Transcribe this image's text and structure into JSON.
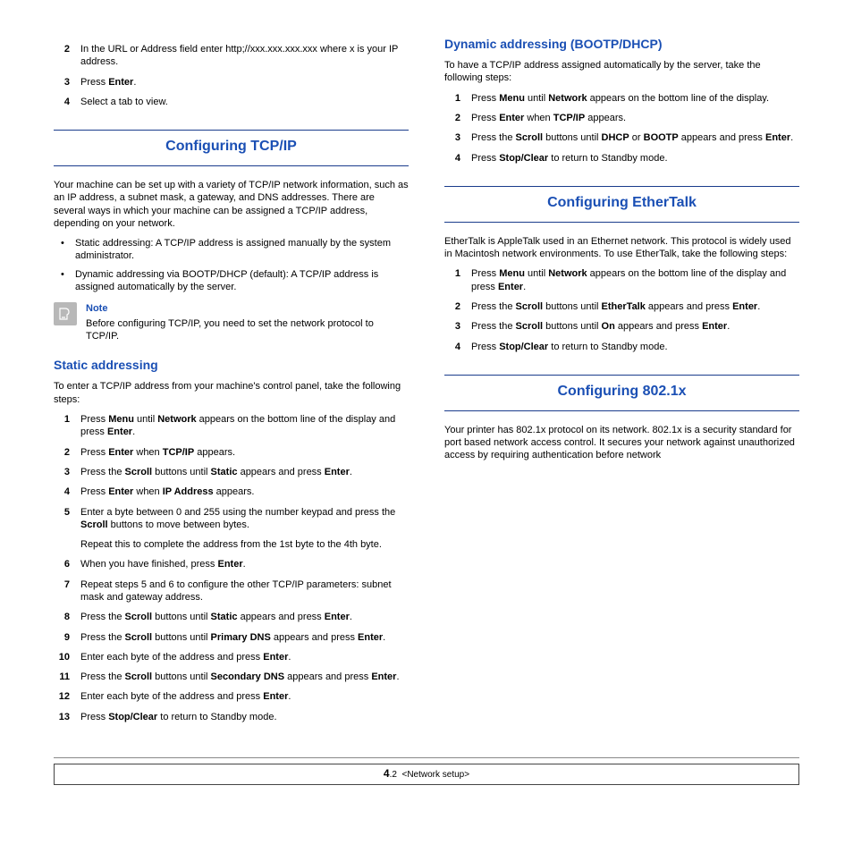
{
  "left": {
    "presteps": [
      {
        "n": "2",
        "t": "In the URL or Address field enter http;//xxx.xxx.xxx.xxx where x is your IP address."
      },
      {
        "n": "3",
        "t": "Press <b>Enter</b>."
      },
      {
        "n": "4",
        "t": "Select a tab to view."
      }
    ],
    "s1": {
      "title": "Configuring TCP/IP",
      "intro": "Your machine can be set up with a variety of TCP/IP network information, such as an IP address, a subnet mask, a gateway, and DNS addresses. There are several ways in which your machine can be assigned a TCP/IP address, depending on your network.",
      "bullets": [
        "Static addressing: A TCP/IP address is assigned manually by the system administrator.",
        "Dynamic addressing via BOOTP/DHCP (default): A TCP/IP address is assigned automatically by the server."
      ],
      "noteTitle": "Note",
      "noteText": "Before configuring TCP/IP, you need to set the network protocol to TCP/IP."
    },
    "static": {
      "title": "Static addressing",
      "intro": "To enter a TCP/IP address from your machine's control panel, take the following steps:",
      "steps": [
        {
          "n": "1",
          "t": "Press <b>Menu</b> until <b>Network</b> appears on the bottom line of the display and press <b>Enter</b>."
        },
        {
          "n": "2",
          "t": "Press <b>Enter</b> when <b>TCP/IP</b> appears."
        },
        {
          "n": "3",
          "t": "Press the <b>Scroll</b> buttons until <b>Static</b> appears and press <b>Enter</b>."
        },
        {
          "n": "4",
          "t": "Press <b>Enter</b> when <b>IP Address</b> appears."
        },
        {
          "n": "5",
          "t": "Enter a byte between 0 and 255 using the number keypad and press the <b>Scroll</b> buttons to move between bytes."
        },
        {
          "n": "",
          "t": "Repeat this to complete the address from the 1st byte to the 4th byte.",
          "indent": true
        },
        {
          "n": "6",
          "t": "When you have finished, press <b>Enter</b>."
        },
        {
          "n": "7",
          "t": "Repeat steps 5 and 6 to configure the other TCP/IP parameters: subnet mask and gateway address."
        },
        {
          "n": "8",
          "t": "Press the <b>Scroll</b> buttons until <b>Static</b> appears and press <b>Enter</b>."
        },
        {
          "n": "9",
          "t": "Press the <b>Scroll</b> buttons until <b>Primary DNS</b> appears and press <b>Enter</b>."
        },
        {
          "n": "10",
          "t": "Enter each byte of the address and press <b>Enter</b>."
        },
        {
          "n": "11",
          "t": "Press the <b>Scroll</b> buttons until <b>Secondary DNS</b> appears and press <b>Enter</b>."
        },
        {
          "n": "12",
          "t": "Enter each byte of the address and press <b>Enter</b>."
        },
        {
          "n": "13",
          "t": "Press <b>Stop/Clear</b> to return to Standby mode."
        }
      ]
    }
  },
  "right": {
    "dyn": {
      "title": "Dynamic addressing (BOOTP/DHCP)",
      "intro": "To have a TCP/IP address assigned automatically by the server, take the following steps:",
      "steps": [
        {
          "n": "1",
          "t": "Press <b>Menu</b> until <b>Network</b> appears on the bottom line of the display."
        },
        {
          "n": "2",
          "t": "Press <b>Enter</b> when <b>TCP/IP</b> appears."
        },
        {
          "n": "3",
          "t": "Press the <b>Scroll</b> buttons until <b>DHCP</b> or <b>BOOTP</b> appears and press <b>Enter</b>."
        },
        {
          "n": "4",
          "t": "Press <b>Stop/Clear</b> to return to Standby mode."
        }
      ]
    },
    "ether": {
      "title": "Configuring EtherTalk",
      "intro": "EtherTalk is AppleTalk used in an Ethernet network. This protocol is widely used in Macintosh network environments. To use EtherTalk, take the following steps:",
      "steps": [
        {
          "n": "1",
          "t": "Press <b>Menu</b> until <b>Network</b> appears on the bottom line of the display and press <b>Enter</b>."
        },
        {
          "n": "2",
          "t": "Press the <b>Scroll</b> buttons until <b>EtherTalk</b> appears and press <b>Enter</b>."
        },
        {
          "n": "3",
          "t": "Press the <b>Scroll</b> buttons until <b>On</b> appears and press <b>Enter</b>."
        },
        {
          "n": "4",
          "t": "Press <b>Stop/Clear</b> to return to Standby mode."
        }
      ]
    },
    "x802": {
      "title": "Configuring 802.1x",
      "intro": "Your printer has 802.1x protocol on its network. 802.1x is a security standard for port based network access control. It secures your network against unauthorized access by requiring authentication before network"
    }
  },
  "footer": {
    "page": "4",
    "sub": ".2",
    "label": "<Network setup>"
  }
}
